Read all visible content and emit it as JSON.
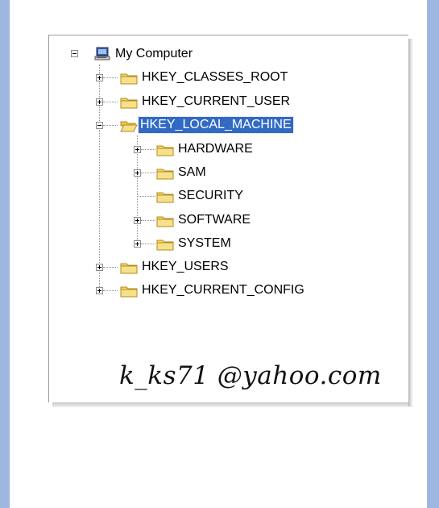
{
  "tree": {
    "root": {
      "label": "My Computer",
      "icon": "computer-icon",
      "expanded": true
    },
    "hives": [
      {
        "label": "HKEY_CLASSES_ROOT",
        "expanded": false
      },
      {
        "label": "HKEY_CURRENT_USER",
        "expanded": false
      },
      {
        "label": "HKEY_LOCAL_MACHINE",
        "expanded": true,
        "selected": true
      },
      {
        "label": "HKEY_USERS",
        "expanded": false
      },
      {
        "label": "HKEY_CURRENT_CONFIG",
        "expanded": false
      }
    ],
    "local_machine_children": [
      {
        "label": "HARDWARE",
        "has_children": true
      },
      {
        "label": "SAM",
        "has_children": true
      },
      {
        "label": "SECURITY",
        "has_children": false
      },
      {
        "label": "SOFTWARE",
        "has_children": true
      },
      {
        "label": "SYSTEM",
        "has_children": true
      }
    ]
  },
  "watermark": "k_ks71 @yahoo.com",
  "colors": {
    "selection": "#316ac5",
    "side_strip": "#9db7e0",
    "folder_fill": "#f4d56a",
    "folder_stroke": "#b08d1e"
  }
}
